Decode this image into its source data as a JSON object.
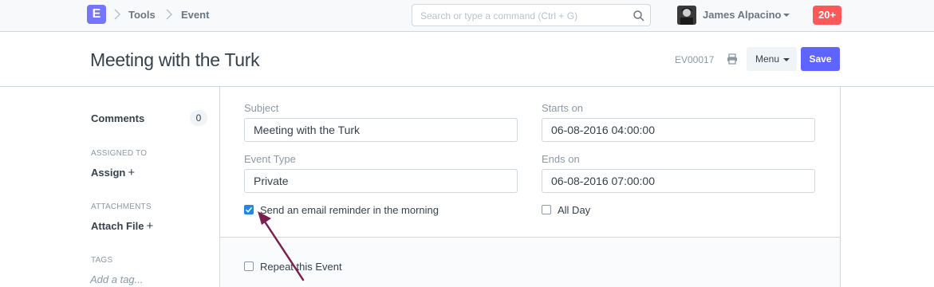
{
  "navbar": {
    "logo_letter": "E",
    "breadcrumbs": [
      "Tools",
      "Event"
    ],
    "search_placeholder": "Search or type a command (Ctrl + G)",
    "user_name": "James Alpacino",
    "notification_count": "20+"
  },
  "page_head": {
    "title": "Meeting with the Turk",
    "doc_id": "EV00017",
    "menu_label": "Menu",
    "save_label": "Save"
  },
  "sidebar": {
    "comments_label": "Comments",
    "comments_count": "0",
    "assigned_heading": "ASSIGNED TO",
    "assign_label": "Assign",
    "attachments_heading": "ATTACHMENTS",
    "attach_label": "Attach File",
    "tags_heading": "TAGS",
    "tag_placeholder": "Add a tag..."
  },
  "form": {
    "subject_label": "Subject",
    "subject_value": "Meeting with the Turk",
    "event_type_label": "Event Type",
    "event_type_value": "Private",
    "starts_on_label": "Starts on",
    "starts_on_value": "06-08-2016 04:00:00",
    "ends_on_label": "Ends on",
    "ends_on_value": "06-08-2016 07:00:00",
    "send_reminder_label": "Send an email reminder in the morning",
    "send_reminder_checked": true,
    "all_day_label": "All Day",
    "all_day_checked": false,
    "repeat_label": "Repeat this Event",
    "repeat_checked": false
  },
  "colors": {
    "accent": "#5e64ff",
    "logo": "#7575ff",
    "notification": "#ff5858",
    "checkbox_checked": "#1e88e5",
    "annotation_arrow": "#7a1f4f"
  }
}
